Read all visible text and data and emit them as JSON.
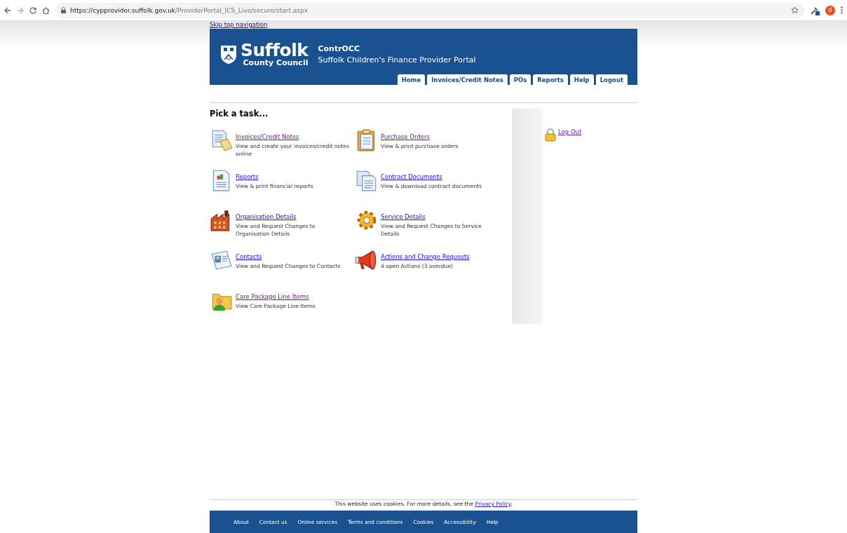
{
  "browser": {
    "url_host": "https://cypprovider.suffolk.gov.uk",
    "url_path": "/ProviderPortal_ICS_Live/secure/start.aspx",
    "profile_initial": "d"
  },
  "skip_link": "Skip top navigation",
  "header": {
    "logo_main": "Suffolk",
    "logo_sub": "County Council",
    "app_name": "ContrOCC",
    "app_subtitle": "Suffolk Children's Finance Provider Portal",
    "tabs": [
      {
        "label": "Home"
      },
      {
        "label": "Invoices/Credit Notes"
      },
      {
        "label": "POs"
      },
      {
        "label": "Reports"
      },
      {
        "label": "Help"
      },
      {
        "label": "Logout"
      }
    ]
  },
  "heading": "Pick a task...",
  "tasks": [
    {
      "title": "Invoices/Credit Notes",
      "description": "View and create your invoices/credit notes online",
      "visited": true
    },
    {
      "title": "Purchase Orders",
      "description": "View & print purchase orders",
      "visited": true
    },
    {
      "title": "Reports",
      "description": "View & print financial reports",
      "visited": false
    },
    {
      "title": "Contract Documents",
      "description": "View & download contract documents",
      "visited": false
    },
    {
      "title": "Organisation Details",
      "description": "View and Request Changes to Organisation Details",
      "visited": false
    },
    {
      "title": "Service Details",
      "description": "View and Request Changes to Service Details",
      "visited": false
    },
    {
      "title": "Contacts",
      "description": "View and Request Changes to Contacts",
      "visited": false
    },
    {
      "title": "Actions and Change Requests",
      "description": "4 open Actions (3 overdue)",
      "visited": false
    },
    {
      "title": "Care Package Line Items",
      "description": "View Care Package Line Items",
      "visited": true
    }
  ],
  "sidebar": {
    "logout_link": {
      "label": "Log Out",
      "visited": true
    }
  },
  "footer": {
    "cookie_text": "This website uses cookies. For more details, see the ",
    "cookie_link": "Privacy Policy",
    "cookie_end": ".",
    "links": [
      "About",
      "Contact us",
      "Online services",
      "Terms and conditions",
      "Cookies",
      "Accessibility",
      "Help"
    ]
  }
}
